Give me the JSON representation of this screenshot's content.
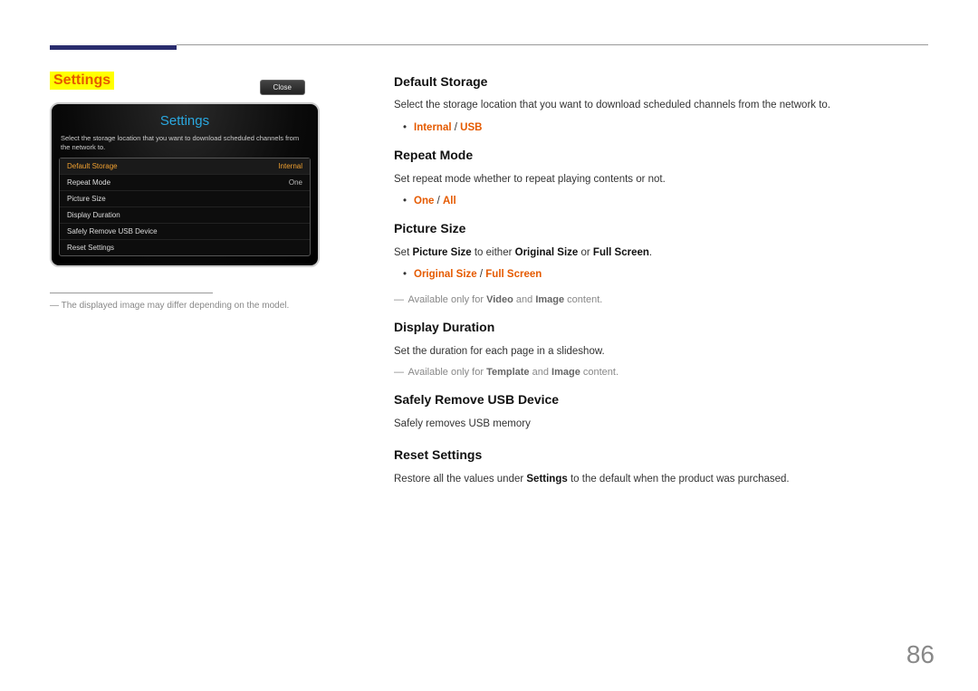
{
  "pageNumber": "86",
  "sectionTitle": "Settings",
  "device": {
    "title": "Settings",
    "description": "Select the storage location that you want to download scheduled channels from the network to.",
    "rows": [
      {
        "label": "Default Storage",
        "value": "Internal",
        "selected": true
      },
      {
        "label": "Repeat Mode",
        "value": "One"
      },
      {
        "label": "Picture Size",
        "value": ""
      },
      {
        "label": "Display Duration",
        "value": ""
      },
      {
        "label": "Safely Remove USB Device",
        "value": ""
      },
      {
        "label": "Reset Settings",
        "value": ""
      }
    ],
    "closeLabel": "Close"
  },
  "footnote": "The displayed image may differ depending on the model.",
  "sections": {
    "defaultStorage": {
      "heading": "Default Storage",
      "desc": "Select the storage location that you want to download scheduled channels from the network to.",
      "opt1": "Internal",
      "sep": " / ",
      "opt2": "USB"
    },
    "repeatMode": {
      "heading": "Repeat Mode",
      "desc": "Set repeat mode whether to repeat playing contents or not.",
      "opt1": "One",
      "sep": " / ",
      "opt2": "All"
    },
    "pictureSize": {
      "heading": "Picture Size",
      "descPrefix": "Set ",
      "descBold1": "Picture Size",
      "descMid": " to either ",
      "descBold2": "Original Size",
      "descMid2": " or ",
      "descBold3": "Full Screen",
      "descSuffix": ".",
      "opt1": "Original Size",
      "sep": " / ",
      "opt2": "Full Screen",
      "notePrefix": "Available only for ",
      "noteBold1": "Video",
      "noteMid": " and ",
      "noteBold2": "Image",
      "noteSuffix": " content."
    },
    "displayDuration": {
      "heading": "Display Duration",
      "desc": "Set the duration for each page in a slideshow.",
      "notePrefix": "Available only for ",
      "noteBold1": "Template",
      "noteMid": " and ",
      "noteBold2": "Image",
      "noteSuffix": " content."
    },
    "safelyRemove": {
      "heading": "Safely Remove USB Device",
      "desc": "Safely removes USB memory"
    },
    "resetSettings": {
      "heading": "Reset Settings",
      "descPrefix": "Restore all the values under ",
      "descBold": "Settings",
      "descSuffix": " to the default when the product was purchased."
    }
  }
}
